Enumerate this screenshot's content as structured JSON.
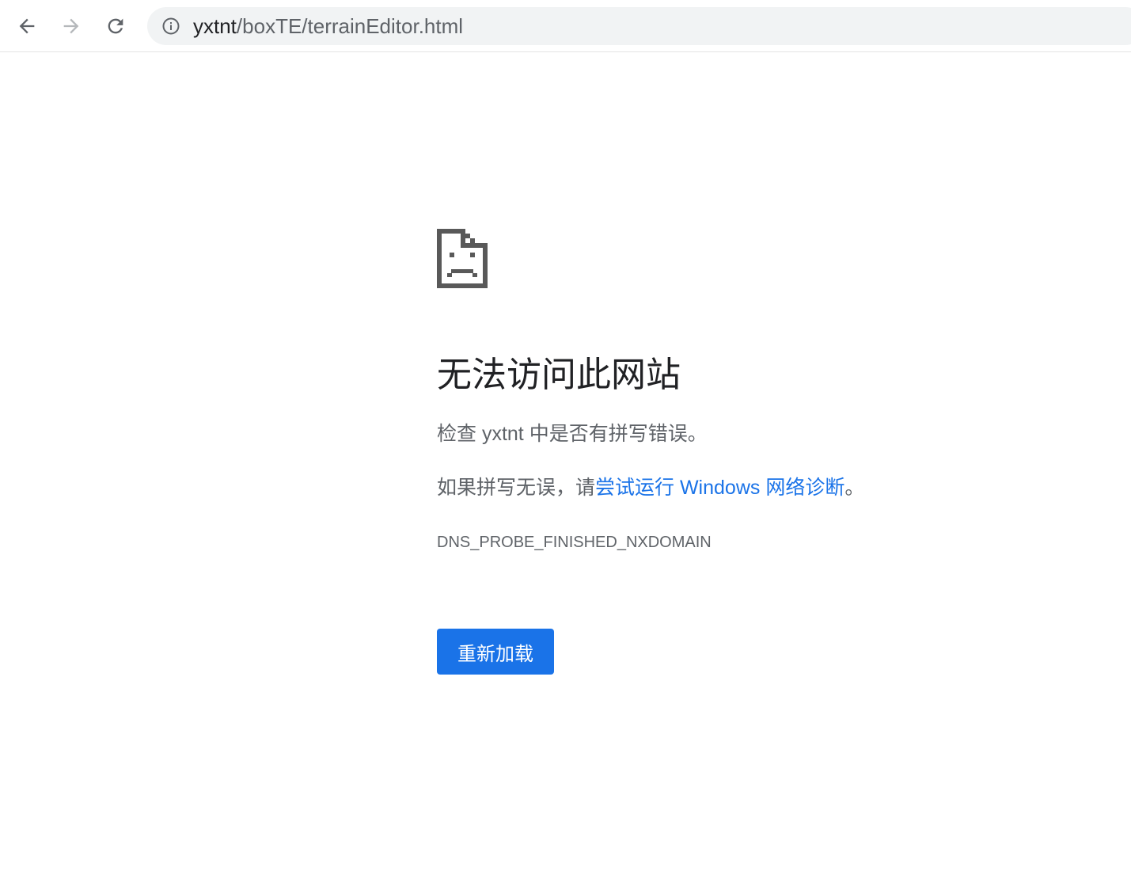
{
  "browser": {
    "back_icon": "arrow-left-icon",
    "forward_icon": "arrow-right-icon",
    "reload_icon": "reload-icon",
    "site_info_icon": "info-circle-icon",
    "url_host": "yxtnt",
    "url_path": "/boxTE/terrainEditor.html"
  },
  "error_page": {
    "icon": "sad-document-icon",
    "title": "无法访问此网站",
    "check_prefix": "检查 ",
    "check_host": "yxtnt",
    "check_suffix": " 中是否有拼写错误。",
    "suggestion_prefix": "如果拼写无误，请",
    "suggestion_link": "尝试运行 Windows 网络诊断",
    "suggestion_suffix": "。",
    "error_code": "DNS_PROBE_FINISHED_NXDOMAIN",
    "reload_label": "重新加载"
  },
  "colors": {
    "accent": "#1a73e8",
    "text_primary": "#202124",
    "text_secondary": "#5f6368",
    "omnibox_bg": "#f1f3f4"
  }
}
